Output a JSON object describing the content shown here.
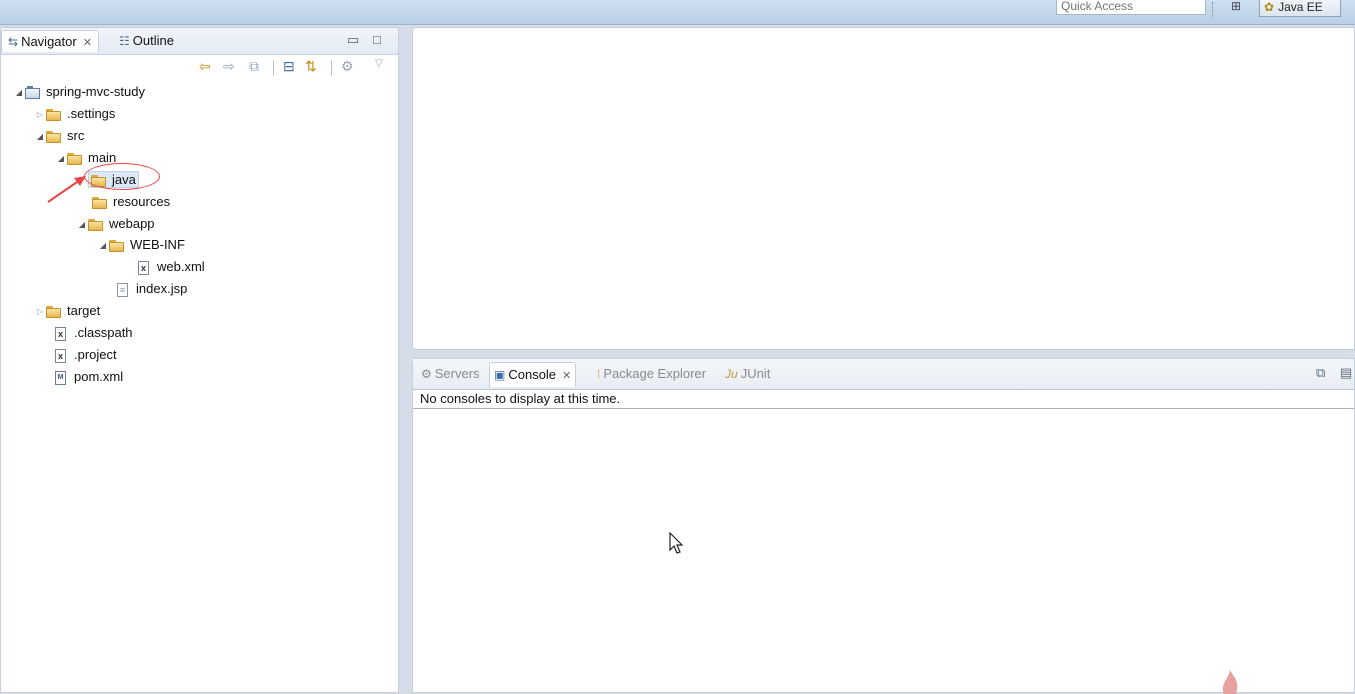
{
  "toolbar": {
    "quick_access_placeholder": "Quick Access",
    "perspective_label": "Java EE"
  },
  "navigator": {
    "tabs": [
      {
        "label": "Navigator",
        "active": true
      },
      {
        "label": "Outline",
        "active": false
      }
    ],
    "tree": [
      {
        "label": "spring-mvc-study",
        "type": "project",
        "state": "expanded"
      },
      {
        "label": ".settings",
        "type": "folder",
        "state": "collapsed"
      },
      {
        "label": "src",
        "type": "folder",
        "state": "expanded"
      },
      {
        "label": "main",
        "type": "folder",
        "state": "expanded"
      },
      {
        "label": "java",
        "type": "folder",
        "state": "leaf",
        "selected": true
      },
      {
        "label": "resources",
        "type": "folder",
        "state": "leaf"
      },
      {
        "label": "webapp",
        "type": "folder",
        "state": "expanded"
      },
      {
        "label": "WEB-INF",
        "type": "folder",
        "state": "expanded"
      },
      {
        "label": "web.xml",
        "type": "xml-file"
      },
      {
        "label": "index.jsp",
        "type": "jsp-file"
      },
      {
        "label": "target",
        "type": "folder",
        "state": "collapsed"
      },
      {
        "label": ".classpath",
        "type": "xml-file"
      },
      {
        "label": ".project",
        "type": "xml-file"
      },
      {
        "label": "pom.xml",
        "type": "maven-file"
      }
    ]
  },
  "console": {
    "tabs": [
      {
        "label": "Servers",
        "active": false
      },
      {
        "label": "Console",
        "active": true
      },
      {
        "label": "Package Explorer",
        "active": false
      },
      {
        "label": "JUnit",
        "active": false
      }
    ],
    "message": "No consoles to display at this time."
  },
  "colors": {
    "annotation_red": "#e44444",
    "selection_bg": "#dce8f6"
  }
}
